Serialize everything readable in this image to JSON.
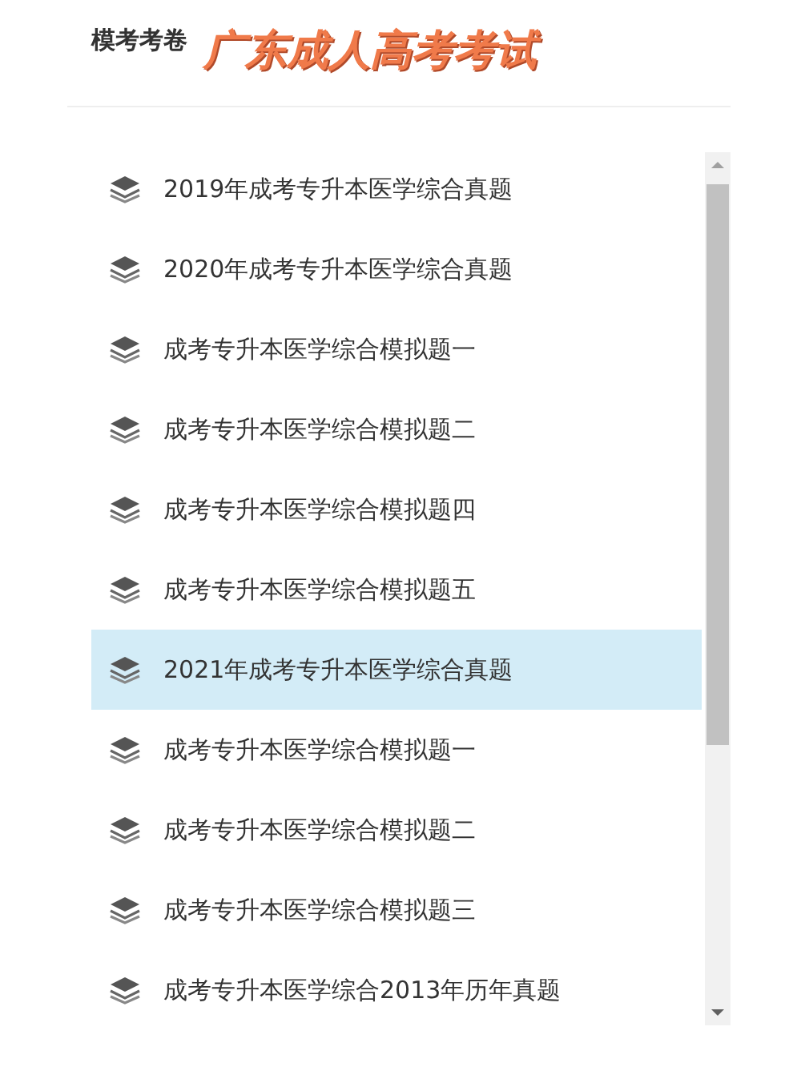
{
  "header": {
    "label": "模考考卷",
    "title": "广东成人高考考试"
  },
  "items": [
    {
      "text": "2019年成考专升本医学综合真题",
      "selected": false
    },
    {
      "text": "2020年成考专升本医学综合真题",
      "selected": false
    },
    {
      "text": "成考专升本医学综合模拟题一",
      "selected": false
    },
    {
      "text": "成考专升本医学综合模拟题二",
      "selected": false
    },
    {
      "text": "成考专升本医学综合模拟题四",
      "selected": false
    },
    {
      "text": "成考专升本医学综合模拟题五",
      "selected": false
    },
    {
      "text": "2021年成考专升本医学综合真题",
      "selected": true
    },
    {
      "text": "成考专升本医学综合模拟题一",
      "selected": false
    },
    {
      "text": "成考专升本医学综合模拟题二",
      "selected": false
    },
    {
      "text": "成考专升本医学综合模拟题三",
      "selected": false
    },
    {
      "text": "成考专升本医学综合2013年历年真题",
      "selected": false
    }
  ]
}
